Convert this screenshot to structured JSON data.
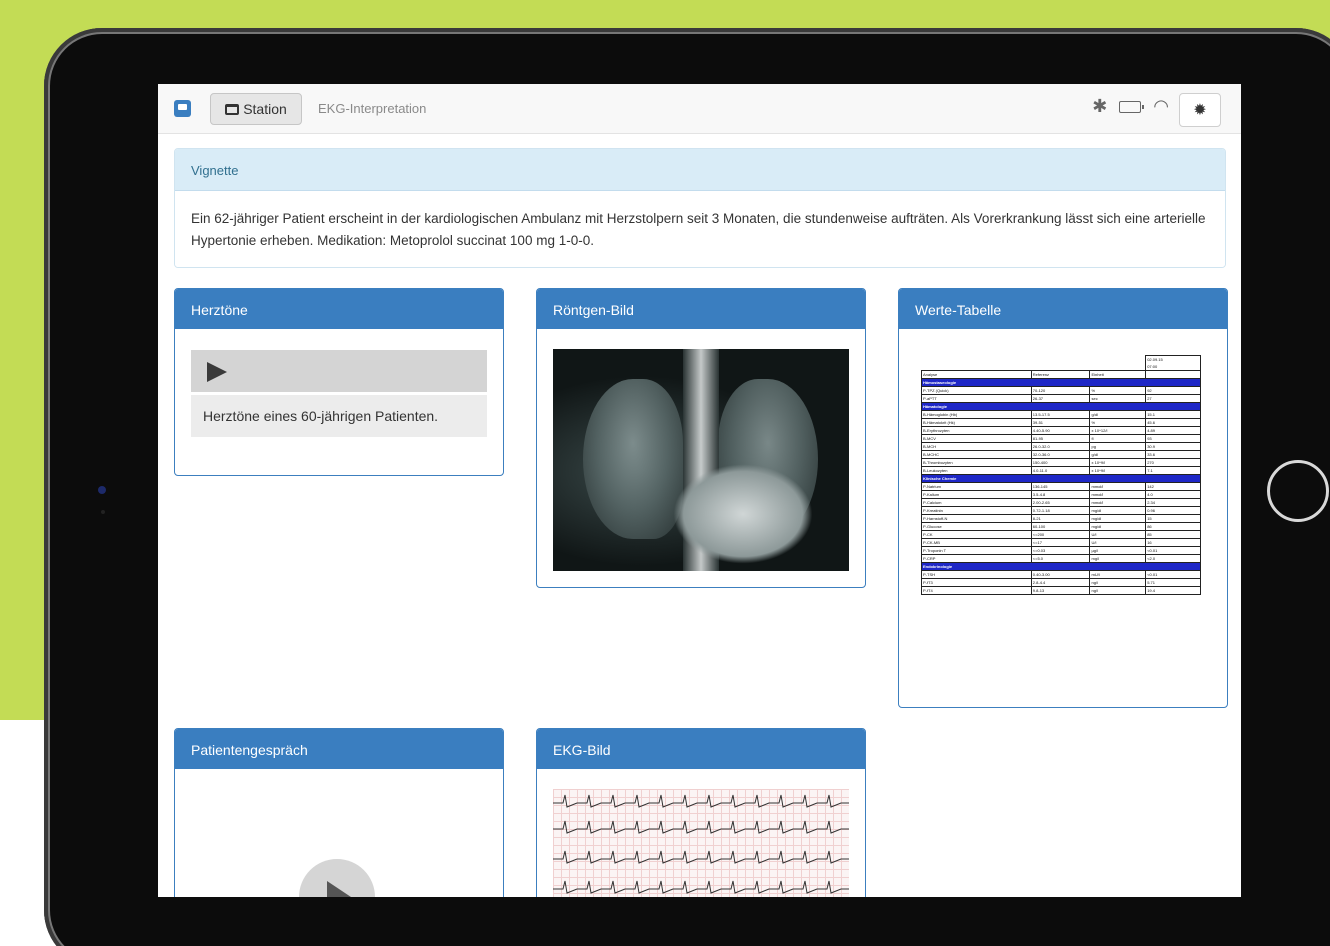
{
  "topbar": {
    "station_label": "Station",
    "breadcrumb": "EKG-Interpretation",
    "icons": [
      "bluetooth-icon",
      "battery-icon",
      "wifi-icon"
    ],
    "settings_icon": "gear-icon"
  },
  "vignette": {
    "title": "Vignette",
    "text": "Ein 62-jähriger Patient erscheint in der kardiologischen Ambulanz mit Herzstolpern seit 3 Monaten, die stundenweise aufträten. Als Vorerkrankung lässt sich eine arterielle Hypertonie erheben. Medikation: Metoprolol succinat 100 mg 1-0-0."
  },
  "panels": {
    "heart_sounds": {
      "title": "Herztöne",
      "caption": "Herztöne eines 60-jährigen Patienten."
    },
    "xray": {
      "title": "Röntgen-Bild"
    },
    "values": {
      "title": "Werte-Tabelle"
    },
    "interview": {
      "title": "Patientengespräch"
    },
    "ekg": {
      "title": "EKG-Bild"
    }
  },
  "lab_table": {
    "date_header": [
      "02.09.15",
      "07:00"
    ],
    "columns": [
      "Analyse",
      "Referenz",
      "Einheit",
      ""
    ],
    "sections": [
      {
        "name": "Hämostaseologie",
        "rows": [
          [
            "P-TPZ (Quick)",
            "70-120",
            "%",
            "92"
          ],
          [
            "P-aPTT",
            "26-37",
            "sec",
            "27"
          ]
        ]
      },
      {
        "name": "Hämatologie",
        "rows": [
          [
            "B-Hämoglobin (Hb)",
            "13.5-17.5",
            "g/dl",
            "15.1"
          ],
          [
            "B-Hämatokrit (Hk)",
            "39-51",
            "%",
            "45.6"
          ],
          [
            "B-Erythrozyten",
            "4.40-5.90",
            "x 10^12/l",
            "4.89"
          ],
          [
            "B-MCV",
            "81-95",
            "fl",
            "93"
          ],
          [
            "B-MCH",
            "26.0-32.0",
            "pg",
            "30.9"
          ],
          [
            "B-MCHC",
            "32.0-36.0",
            "g/dl",
            "33.6"
          ],
          [
            "B-Thrombozyten",
            "150-400",
            "x 10^9/l",
            "270"
          ],
          [
            "B-Leukozyten",
            "4.0-11.0",
            "x 10^9/l",
            "7.1"
          ]
        ]
      },
      {
        "name": "Klinische Chemie",
        "rows": [
          [
            "P-Natrium",
            "136-145",
            "mmol/l",
            "142"
          ],
          [
            "P-Kalium",
            "3.5-4.8",
            "mmol/l",
            "4.0"
          ],
          [
            "P-Calcium",
            "2.00-2.65",
            "mmol/l",
            "2.34"
          ],
          [
            "P-Kreatinin",
            "0.72-1.18",
            "mg/dl",
            "0.96"
          ],
          [
            "P-Harnstoff-N",
            "8-21",
            "mg/dl",
            "15"
          ],
          [
            "P-Glucose",
            "60-100",
            "mg/dl",
            "86"
          ],
          [
            "P-CK",
            "<=200",
            "U/l",
            "85"
          ],
          [
            "P-CK-MB",
            "<=17",
            "U/l",
            "16"
          ],
          [
            "P-Troponin T",
            "<=0.03",
            "µg/l",
            "<0.01"
          ],
          [
            "P-CRP",
            "<=5.0",
            "mg/l",
            "<2.0"
          ]
        ]
      },
      {
        "name": "Endokrinologie",
        "rows": [
          [
            "P-TSH",
            "0.40-3.00",
            "mU/l",
            "<0.01"
          ],
          [
            "P-fT3",
            "2.8-4.4",
            "ng/l",
            "5.71"
          ],
          [
            "P-fT4",
            "9.8-13",
            "ng/l",
            "19.4"
          ]
        ]
      }
    ]
  }
}
